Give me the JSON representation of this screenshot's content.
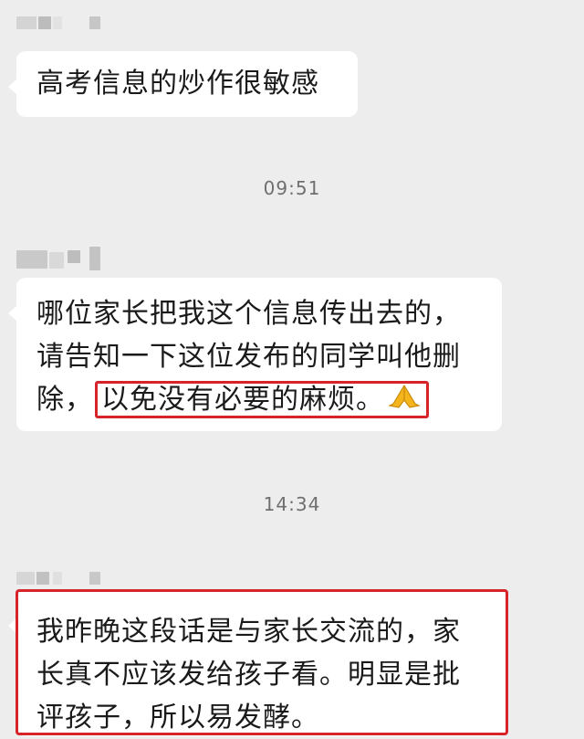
{
  "messages": [
    {
      "text": "高考信息的炒作很敏感"
    },
    {
      "text_before": "哪位家长把我这个信息传出去的，请告知一下这位发布的同学叫他删除，",
      "text_line1": "哪位家长把我这个信息传出去的，",
      "text_line2": "请告知一下这位发布的同学叫他删",
      "text_line3_start": "除，",
      "highlighted": "以免没有必要的麻烦。",
      "emoji": "folded-hands-emoji"
    },
    {
      "line1": "我昨晚这段话是与家长交流的，家",
      "line2": "长真不应该发给孩子看。明显是批",
      "line3": "评孩子，所以易发酵。"
    }
  ],
  "timestamps": [
    "09:51",
    "14:34"
  ],
  "colors": {
    "background": "#ededed",
    "bubble": "#ffffff",
    "highlight": "#d7242a",
    "timestamp": "#6f6f6f"
  }
}
